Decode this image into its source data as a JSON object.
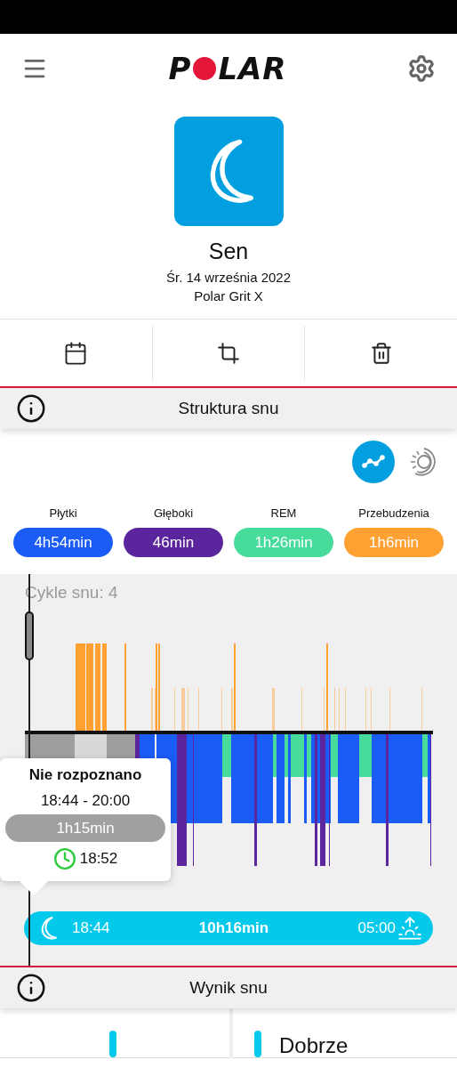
{
  "header": {
    "logo": {
      "left": "P",
      "right": "LAR"
    }
  },
  "activity": {
    "title": "Sen",
    "date": "Śr. 14 września 2022",
    "device": "Polar Grit X"
  },
  "structure": {
    "title": "Struktura snu",
    "views": [
      {
        "kind": "graph",
        "selected": true
      },
      {
        "kind": "rings",
        "selected": false
      }
    ],
    "stages": [
      {
        "label": "Płytki",
        "value": "4h54min",
        "color": "#1a5cf5"
      },
      {
        "label": "Głęboki",
        "value": "46min",
        "color": "#5b259e"
      },
      {
        "label": "REM",
        "value": "1h26min",
        "color": "#48dc9c"
      },
      {
        "label": "Przebudzenia",
        "value": "1h6min",
        "color": "#ffa033"
      }
    ],
    "cycles": "Cykle snu: 4",
    "tooltip": {
      "title": "Nie rozpoznano",
      "range": "18:44 - 20:00",
      "duration": "1h15min",
      "time": "18:52"
    },
    "timeline": {
      "start": "18:44",
      "total": "10h16min",
      "end": "05:00"
    }
  },
  "score": {
    "title": "Wynik snu",
    "label": "Dobrze"
  }
}
